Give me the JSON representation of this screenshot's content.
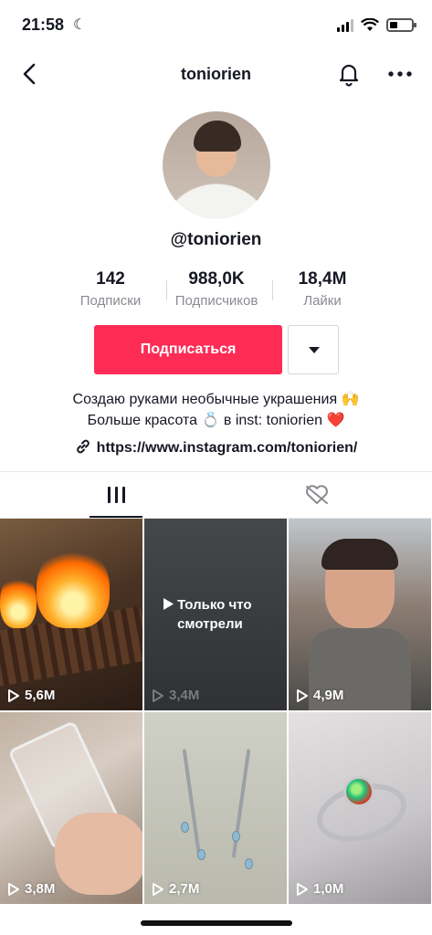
{
  "status_bar": {
    "time": "21:58",
    "battery_level": 0.35,
    "icons": [
      "moon-icon",
      "signal-icon",
      "wifi-icon",
      "battery-icon"
    ]
  },
  "header": {
    "title": "toniorien",
    "icons": [
      "back-arrow-icon",
      "bell-icon",
      "more-dots-icon"
    ]
  },
  "profile": {
    "handle": "@toniorien",
    "stats": [
      {
        "value": "142",
        "label": "Подписки"
      },
      {
        "value": "988,0K",
        "label": "Подписчиков"
      },
      {
        "value": "18,4M",
        "label": "Лайки"
      }
    ],
    "follow_label": "Подписаться",
    "bio_line1": "Создаю руками необычные украшения 🙌",
    "bio_line2": "Больше красота 💍 в inst: toniorien ❤️",
    "link": "https://www.instagram.com/toniorien/"
  },
  "tabs": [
    {
      "icon": "grid-icon",
      "active": true
    },
    {
      "icon": "liked-hidden-icon",
      "active": false
    }
  ],
  "videos": [
    {
      "views": "5,6M"
    },
    {
      "views": "3,4M",
      "overlay": "Только что смотрели"
    },
    {
      "views": "4,9M"
    },
    {
      "views": "3,8M"
    },
    {
      "views": "2,7M"
    },
    {
      "views": "1,0M"
    }
  ],
  "colors": {
    "accent": "#fe2c55",
    "text": "#161823",
    "secondary": "#8a8b91"
  }
}
